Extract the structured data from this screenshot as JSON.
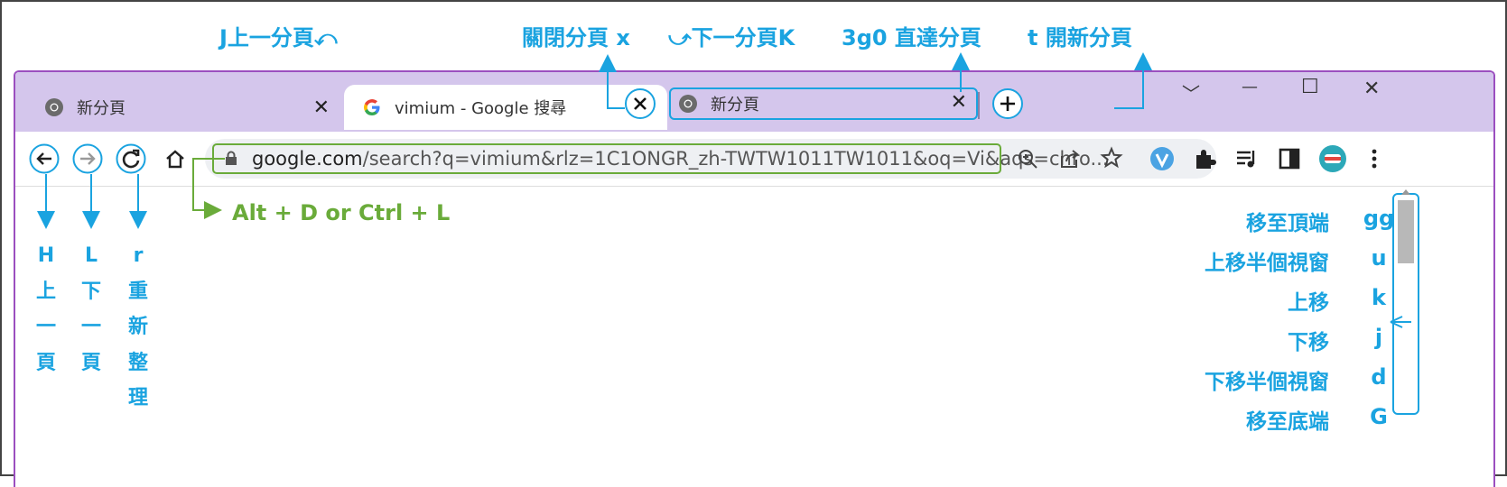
{
  "annotations": {
    "prev_tab": "J上一分頁⤺",
    "close_tab": "關閉分頁 x",
    "next_tab": "⤻下一分頁K",
    "go_to_tab": "3g0 直達分頁",
    "new_tab": "t 開新分頁",
    "address_bar": "Alt + D or Ctrl + L"
  },
  "tabs": [
    {
      "title": "新分頁",
      "icon": "chrome-icon"
    },
    {
      "title": "vimium - Google 搜尋",
      "icon": "google-icon",
      "active": true
    },
    {
      "title": "新分頁",
      "icon": "chrome-icon"
    }
  ],
  "window_controls": {
    "dropdown": "﹀",
    "minimize": "—",
    "maximize": "☐",
    "close": "✕"
  },
  "address": {
    "host": "google.com",
    "path": "/search?q=vimium&rlz=1C1ONGR_zh-TWTW1011TW1011&oq=Vi&aqs=chro..."
  },
  "nav_keys": {
    "back": {
      "key": "H",
      "chars": [
        "上",
        "一",
        "頁"
      ]
    },
    "forward": {
      "key": "L",
      "chars": [
        "下",
        "一",
        "頁"
      ]
    },
    "reload": {
      "key": "r",
      "chars": [
        "重",
        "新",
        "整",
        "理"
      ]
    }
  },
  "scroll_keys": [
    {
      "label": "移至頂端",
      "key": "gg"
    },
    {
      "label": "上移半個視窗",
      "key": "u"
    },
    {
      "label": "上移",
      "key": "k"
    },
    {
      "label": "下移",
      "key": "j"
    },
    {
      "label": "下移半個視窗",
      "key": "d"
    },
    {
      "label": "移至底端",
      "key": "G"
    }
  ],
  "colors": {
    "accent": "#1aa3e0",
    "green": "#6aab3a",
    "frame": "#9b4fbf",
    "tabstrip": "#d4c6ec"
  }
}
